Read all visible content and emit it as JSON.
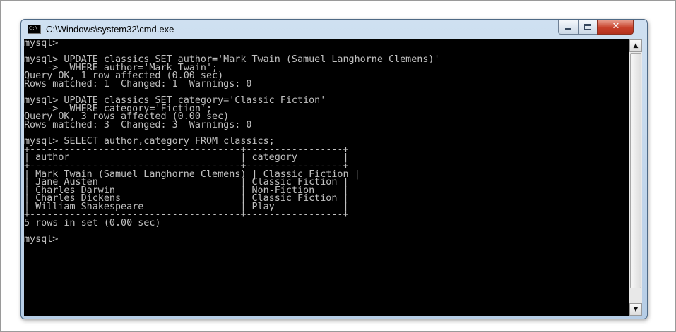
{
  "window": {
    "title": "C:\\Windows\\system32\\cmd.exe",
    "icon_label": "C:\\",
    "close_glyph": "✕"
  },
  "console": {
    "lines": [
      "mysql>",
      "",
      "mysql> UPDATE classics SET author='Mark Twain (Samuel Langhorne Clemens)'",
      "    ->  WHERE author='Mark Twain';",
      "Query OK, 1 row affected (0.00 sec)",
      "Rows matched: 1  Changed: 1  Warnings: 0",
      "",
      "mysql> UPDATE classics SET category='Classic Fiction'",
      "    ->  WHERE category='Fiction';",
      "Query OK, 3 rows affected (0.00 sec)",
      "Rows matched: 3  Changed: 3  Warnings: 0",
      "",
      "mysql> SELECT author,category FROM classics;",
      "+-------------------------------------+-----------------+",
      "| author                              | category        |",
      "+-------------------------------------+-----------------+",
      "| Mark Twain (Samuel Langhorne Clemens) | Classic Fiction |",
      "| Jane Austen                         | Classic Fiction |",
      "| Charles Darwin                      | Non-Fiction     |",
      "| Charles Dickens                     | Classic Fiction |",
      "| William Shakespeare                 | Play            |",
      "+-------------------------------------+-----------------+",
      "5 rows in set (0.00 sec)",
      "",
      "mysql>"
    ]
  },
  "scrollbar": {
    "up_glyph": "▲",
    "down_glyph": "▼"
  },
  "colors": {
    "console_bg": "#000000",
    "console_text": "#c0c0c0",
    "close_button": "#c7402a"
  }
}
